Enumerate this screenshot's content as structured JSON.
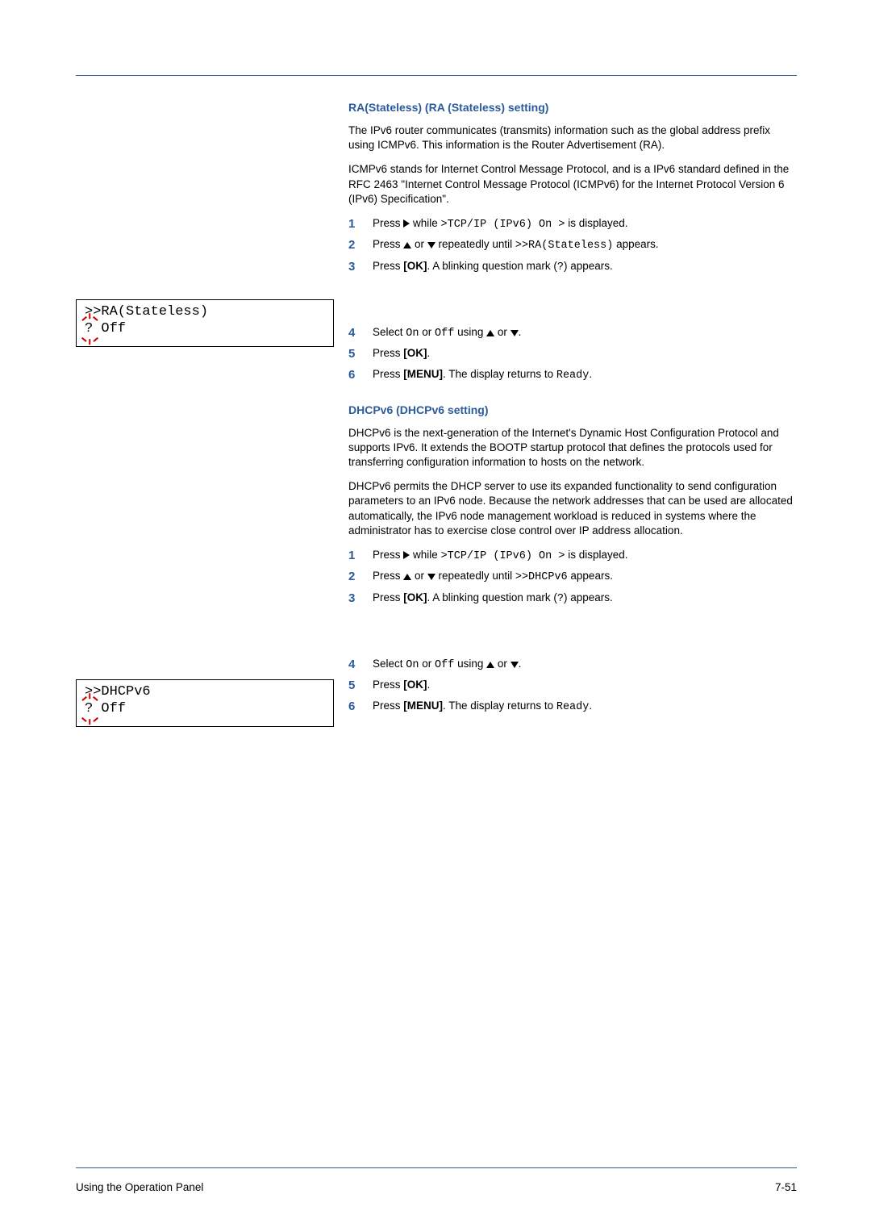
{
  "footer": {
    "left": "Using the Operation Panel",
    "right": "7-51"
  },
  "section1": {
    "heading": "RA(Stateless) (RA (Stateless) setting)",
    "p1": "The IPv6 router communicates (transmits) information such as the global address prefix using ICMPv6. This information is the Router Advertisement (RA).",
    "p2": "ICMPv6 stands for Internet Control Message Protocol, and is a IPv6 standard defined in the RFC 2463 \"Internet Control Message Protocol (ICMPv6) for the Internet Protocol Version 6 (IPv6) Specification\".",
    "lcd": {
      "line1": ">>RA(Stateless)",
      "qmark": "?",
      "value": " Off"
    },
    "steps": {
      "s1a": "Press ",
      "s1b": " while ",
      "s1c": ">TCP/IP (IPv6) On >",
      "s1d": " is displayed.",
      "s2a": "Press ",
      "s2b": " or ",
      "s2c": " repeatedly until ",
      "s2d": ">>RA(Stateless)",
      "s2e": " appears.",
      "s3a": "Press ",
      "s3b": "[OK]",
      "s3c": ". A blinking question mark (",
      "s3d": "?",
      "s3e": ") appears.",
      "s4a": "Select ",
      "s4b": "On",
      "s4c": " or ",
      "s4d": "Off",
      "s4e": " using ",
      "s4f": " or ",
      "s4g": ".",
      "s5a": "Press ",
      "s5b": "[OK]",
      "s5c": ".",
      "s6a": "Press ",
      "s6b": "[MENU]",
      "s6c": ". The display returns to ",
      "s6d": "Ready",
      "s6e": "."
    }
  },
  "section2": {
    "heading": "DHCPv6 (DHCPv6 setting)",
    "p1": "DHCPv6 is the next-generation of the Internet's Dynamic Host Configuration Protocol and supports IPv6. It extends the BOOTP startup protocol that defines the protocols used for transferring configuration information to hosts on the network.",
    "p2": "DHCPv6 permits the DHCP server to use its expanded functionality to send configuration parameters to an IPv6 node. Because the network addresses that can be used are allocated automatically, the IPv6 node management workload is reduced in systems where the administrator has to exercise close control over IP address allocation.",
    "lcd": {
      "line1": ">>DHCPv6",
      "qmark": "?",
      "value": " Off"
    },
    "steps": {
      "s1a": "Press ",
      "s1b": " while ",
      "s1c": ">TCP/IP (IPv6) On >",
      "s1d": " is displayed.",
      "s2a": "Press ",
      "s2b": " or ",
      "s2c": " repeatedly until ",
      "s2d": ">>DHCPv6",
      "s2e": " appears.",
      "s3a": "Press ",
      "s3b": "[OK]",
      "s3c": ". A blinking question mark (",
      "s3d": "?",
      "s3e": ") appears.",
      "s4a": "Select ",
      "s4b": "On",
      "s4c": " or ",
      "s4d": "Off",
      "s4e": " using ",
      "s4f": " or ",
      "s4g": ".",
      "s5a": "Press ",
      "s5b": "[OK]",
      "s5c": ".",
      "s6a": "Press ",
      "s6b": "[MENU]",
      "s6c": ". The display returns to ",
      "s6d": "Ready",
      "s6e": "."
    }
  }
}
